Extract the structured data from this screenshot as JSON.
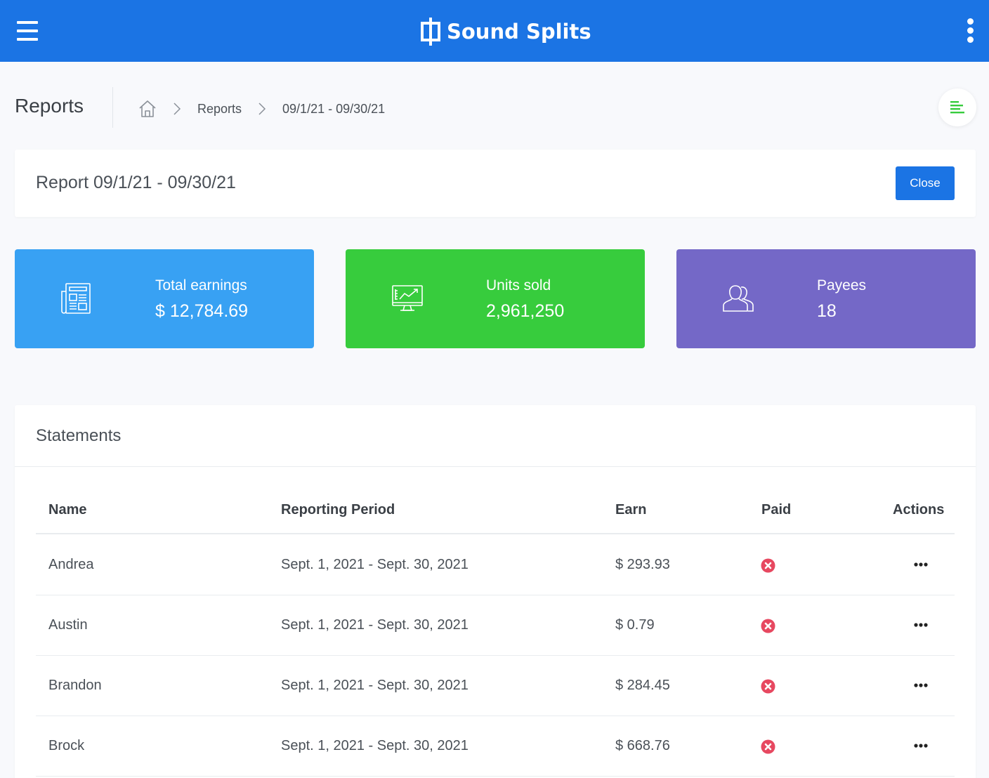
{
  "app": {
    "brand": "Sound Splits",
    "colors": {
      "primary": "#1b74e4",
      "earnings": "#38a1f3",
      "units": "#37cc3d",
      "payees": "#7468c7",
      "unpaid": "#e74860",
      "menu_accent": "#37cc3d"
    }
  },
  "header": {
    "page_title": "Reports",
    "breadcrumb": {
      "home_icon": "home-icon",
      "items": [
        "Reports",
        "09/1/21 - 09/30/21"
      ]
    }
  },
  "report": {
    "title": "Report 09/1/21 - 09/30/21",
    "close_label": "Close"
  },
  "stats": [
    {
      "label": "Total earnings",
      "value": "$ 12,784.69",
      "icon": "newspaper-icon"
    },
    {
      "label": "Units sold",
      "value": "2,961,250",
      "icon": "monitor-chart-icon"
    },
    {
      "label": "Payees",
      "value": "18",
      "icon": "users-icon"
    }
  ],
  "statements": {
    "title": "Statements",
    "columns": [
      "Name",
      "Reporting Period",
      "Earn",
      "Paid",
      "Actions"
    ],
    "rows": [
      {
        "name": "Andrea",
        "period": "Sept. 1, 2021 - Sept. 30, 2021",
        "earn": "$ 293.93",
        "paid": "x-circle-icon",
        "actions": "ellipsis-icon"
      },
      {
        "name": "Austin",
        "period": "Sept. 1, 2021 - Sept. 30, 2021",
        "earn": "$ 0.79",
        "paid": "x-circle-icon",
        "actions": "ellipsis-icon"
      },
      {
        "name": "Brandon",
        "period": "Sept. 1, 2021 - Sept. 30, 2021",
        "earn": "$ 284.45",
        "paid": "x-circle-icon",
        "actions": "ellipsis-icon"
      },
      {
        "name": "Brock",
        "period": "Sept. 1, 2021 - Sept. 30, 2021",
        "earn": "$ 668.76",
        "paid": "x-circle-icon",
        "actions": "ellipsis-icon"
      }
    ]
  }
}
